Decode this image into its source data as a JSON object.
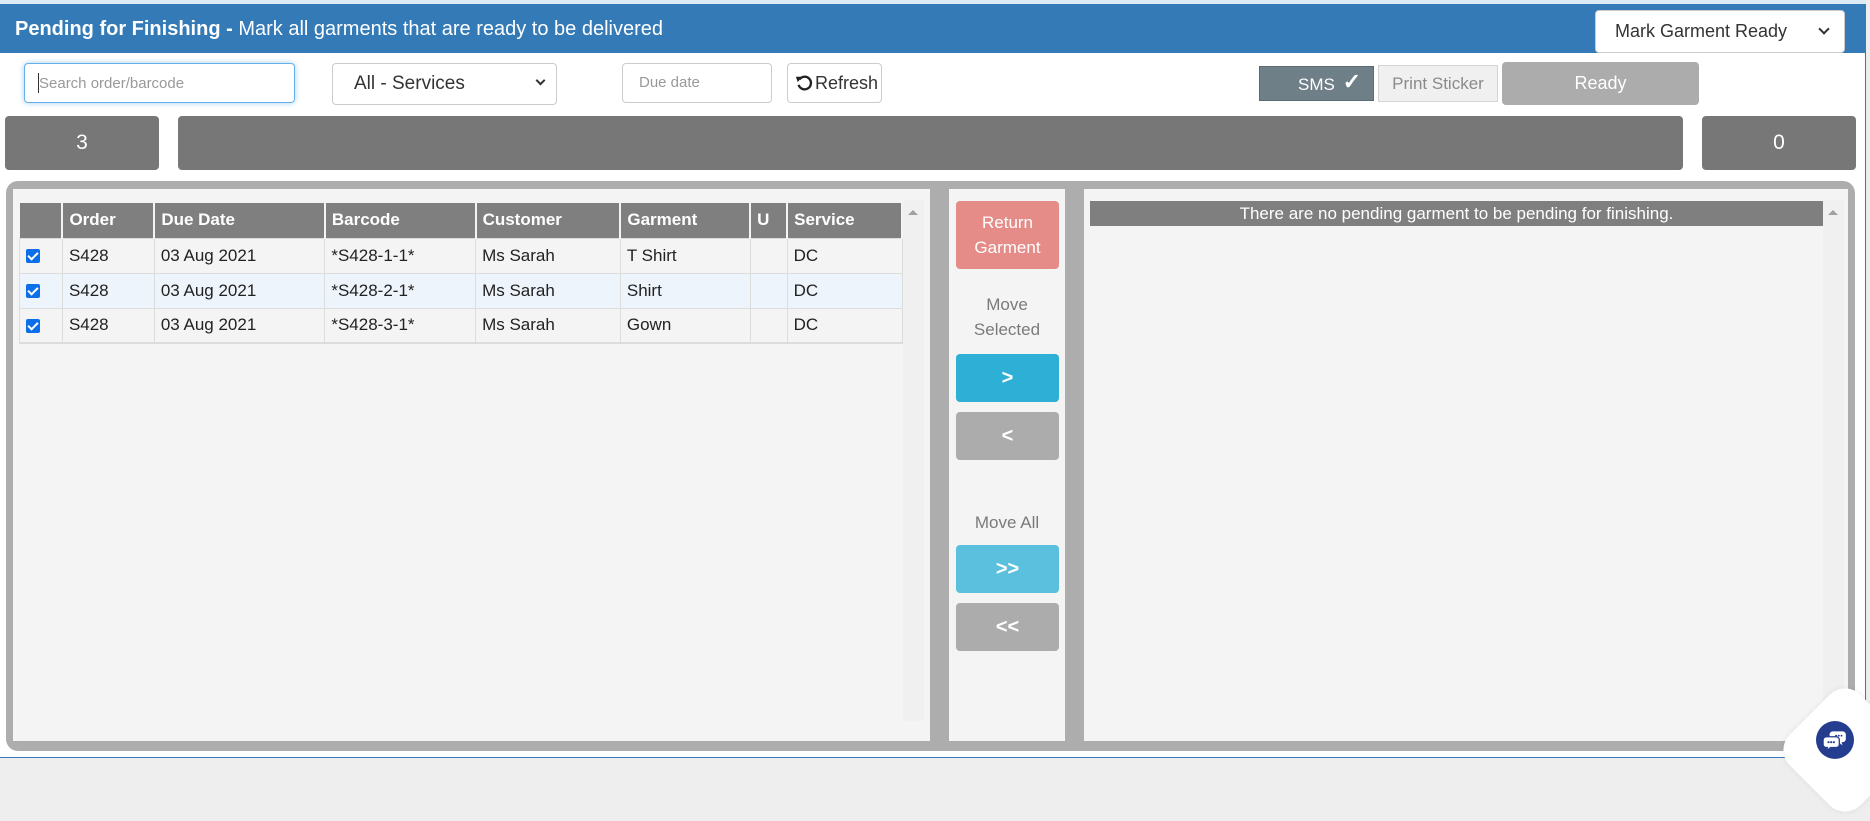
{
  "header": {
    "title_bold": "Pending for Finishing -",
    "title_rest": " Mark all garments that are ready to be delivered",
    "mode_select": {
      "selected": "Mark Garment Ready"
    }
  },
  "toolbar": {
    "search_placeholder": "Search order/barcode",
    "search_value": "",
    "service_select": {
      "selected": "All - Services"
    },
    "due_date_placeholder": "Due date",
    "refresh_label": "Refresh",
    "sms_label": "SMS",
    "sms_checked": true,
    "sms_check_glyph": "✓",
    "print_sticker_label": "Print Sticker",
    "ready_label": "Ready"
  },
  "stats": {
    "left_count": "3",
    "middle_text": "",
    "right_count": "0"
  },
  "left_table": {
    "columns": [
      "",
      "Order",
      "Due Date",
      "Barcode",
      "Customer",
      "Garment",
      "U",
      "Service"
    ],
    "rows": [
      {
        "checked": true,
        "order": "S428",
        "due_date": "03 Aug 2021",
        "barcode": "*S428-1-1*",
        "customer": "Ms Sarah",
        "garment": "T Shirt",
        "u": "",
        "service": "DC"
      },
      {
        "checked": true,
        "order": "S428",
        "due_date": "03 Aug 2021",
        "barcode": "*S428-2-1*",
        "customer": "Ms Sarah",
        "garment": "Shirt",
        "u": "",
        "service": "DC"
      },
      {
        "checked": true,
        "order": "S428",
        "due_date": "03 Aug 2021",
        "barcode": "*S428-3-1*",
        "customer": "Ms Sarah",
        "garment": "Gown",
        "u": "",
        "service": "DC"
      }
    ]
  },
  "middle": {
    "return_garment_line1": "Return",
    "return_garment_line2": "Garment",
    "move_selected_line1": "Move",
    "move_selected_line2": "Selected",
    "move_right_label": ">",
    "move_left_label": "<",
    "move_all_label": "Move All",
    "move_all_right_label": ">>",
    "move_all_left_label": "<<"
  },
  "right_panel": {
    "empty_message": "There are no pending garment to be pending for finishing."
  },
  "colors": {
    "header_bg": "#337ab7",
    "stat_bg": "#777777",
    "move_right_bg": "#2eafd6",
    "move_all_right_bg": "#5bc0de",
    "move_left_bg": "#acacac",
    "return_bg": "#e58c88",
    "chat_bg": "#253d8f"
  }
}
